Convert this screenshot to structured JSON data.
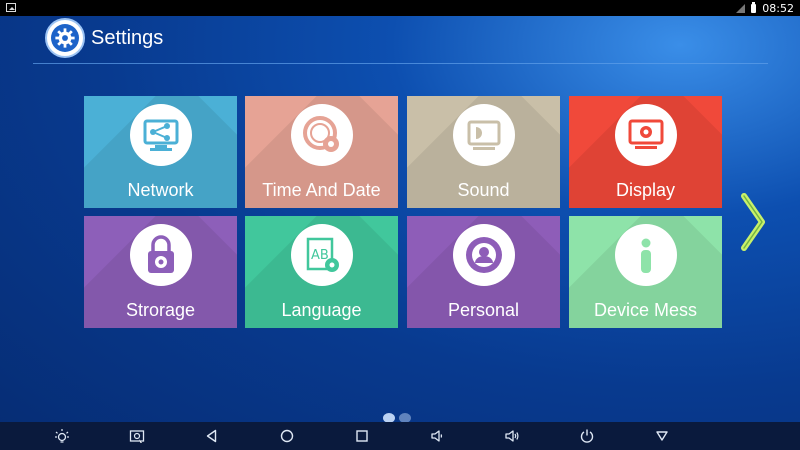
{
  "status_bar": {
    "time": "08:52"
  },
  "header": {
    "title": "Settings"
  },
  "tiles": [
    {
      "label": "Network",
      "color": "#4bb0d6",
      "icon": "network-monitor-icon"
    },
    {
      "label": "Time And Date",
      "color": "#e6a395",
      "icon": "clock-gear-icon"
    },
    {
      "label": "Sound",
      "color": "#c9bfa8",
      "icon": "speaker-monitor-icon"
    },
    {
      "label": "Display",
      "color": "#f0493a",
      "icon": "display-gear-icon"
    },
    {
      "label": "Strorage",
      "color": "#8d5fb9",
      "icon": "padlock-gear-icon"
    },
    {
      "label": "Language",
      "color": "#41c79c",
      "icon": "ab-document-icon"
    },
    {
      "label": "Personal",
      "color": "#8e5db8",
      "icon": "person-gear-icon"
    },
    {
      "label": "Device Mess",
      "color": "#8ee3a9",
      "icon": "info-icon"
    }
  ],
  "colors": {
    "accent": "#1d63c9",
    "arrow": "#c8f06a",
    "navbar": "#0a1a3d"
  },
  "pagination": {
    "current": 1,
    "total": 2
  },
  "nav_icons": [
    "brightness-icon",
    "screenshot-icon",
    "back-icon",
    "home-icon",
    "recents-icon",
    "volume-down-icon",
    "volume-up-icon",
    "power-icon",
    "menu-down-icon"
  ]
}
